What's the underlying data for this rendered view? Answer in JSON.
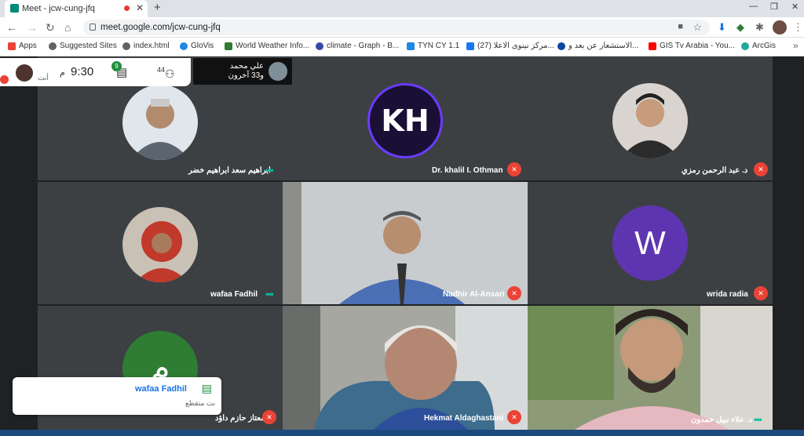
{
  "browser": {
    "tab_title": "Meet - jcw-cung-jfq",
    "url": "meet.google.com/jcw-cung-jfq",
    "bookmarks": [
      {
        "label": "Apps",
        "color": "#ea4335"
      },
      {
        "label": "Suggested Sites",
        "color": "#5f6368"
      },
      {
        "label": "index.html",
        "color": "#5f6368"
      },
      {
        "label": "GloVis",
        "color": "#1e88e5"
      },
      {
        "label": "World Weather Info...",
        "color": "#2e7d32"
      },
      {
        "label": "climate - Graph - B...",
        "color": "#3949ab"
      },
      {
        "label": "TYN CY 1.1",
        "color": "#1e88e5"
      },
      {
        "label": "(27) مركز نينوى الاعلا...",
        "color": "#1877f2"
      },
      {
        "label": "الاستشعار عن بعد و...",
        "color": "#0d47a1"
      },
      {
        "label": "GIS Tv Arabia - You...",
        "color": "#ff0000"
      },
      {
        "label": "ArcGis",
        "color": "#26a69a"
      }
    ]
  },
  "meeting": {
    "time": "9:30",
    "time_suffix": "م",
    "you_label": "أنت",
    "chat_count": "9",
    "people_count": "44",
    "presenter_name": "علي محمد",
    "presenter_more": "و33 آخرون"
  },
  "tiles": [
    {
      "name": "ابراهيم سعد ابراهيم خضر",
      "muted": false,
      "avatar_color": "#dfe6ec"
    },
    {
      "name": "Dr. khalil I. Othman",
      "muted": true,
      "avatar_color": "#1a1035",
      "initials": "KH"
    },
    {
      "name": "د. عبد الرحمن رمزي",
      "muted": true,
      "avatar_color": "#d9d4cf"
    },
    {
      "name": "wafaa Fadhil",
      "muted": false,
      "avatar_color": "#c9c1b6"
    },
    {
      "name": "Nadhir Al-Ansari",
      "muted": true
    },
    {
      "name": "wrida radia",
      "muted": true,
      "avatar_color": "#5e35b1",
      "initials": "W"
    },
    {
      "name": "معتاز حازم داؤد",
      "muted": true,
      "avatar_color": "#2e7d32",
      "initials": "م"
    },
    {
      "name": "Hekmat Aldaghastani",
      "muted": true
    },
    {
      "name": "د. علاء نبيل حمدون",
      "muted": false
    }
  ],
  "chat_popup": {
    "sender": "wafaa Fadhil",
    "message": "نت متقطع"
  }
}
